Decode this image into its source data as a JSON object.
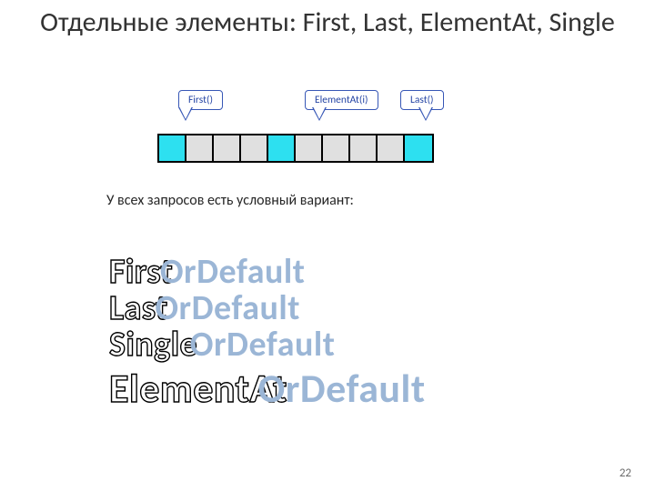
{
  "title": "Отдельные элементы: First, Last, ElementAt, Single",
  "callouts": {
    "first": "First()",
    "elementAt": "ElementAt(i)",
    "last": "Last()"
  },
  "array": {
    "cells": 10,
    "highlighted": [
      0,
      4,
      9
    ]
  },
  "note": "У всех запросов есть условный вариант:",
  "methods": [
    {
      "name": "First",
      "suffix": "OrDefault"
    },
    {
      "name": "Last",
      "suffix": "OrDefault"
    },
    {
      "name": "Single",
      "suffix": "OrDefault"
    },
    {
      "name": "ElementAt",
      "suffix": "OrDefault"
    }
  ],
  "pageNumber": "22"
}
